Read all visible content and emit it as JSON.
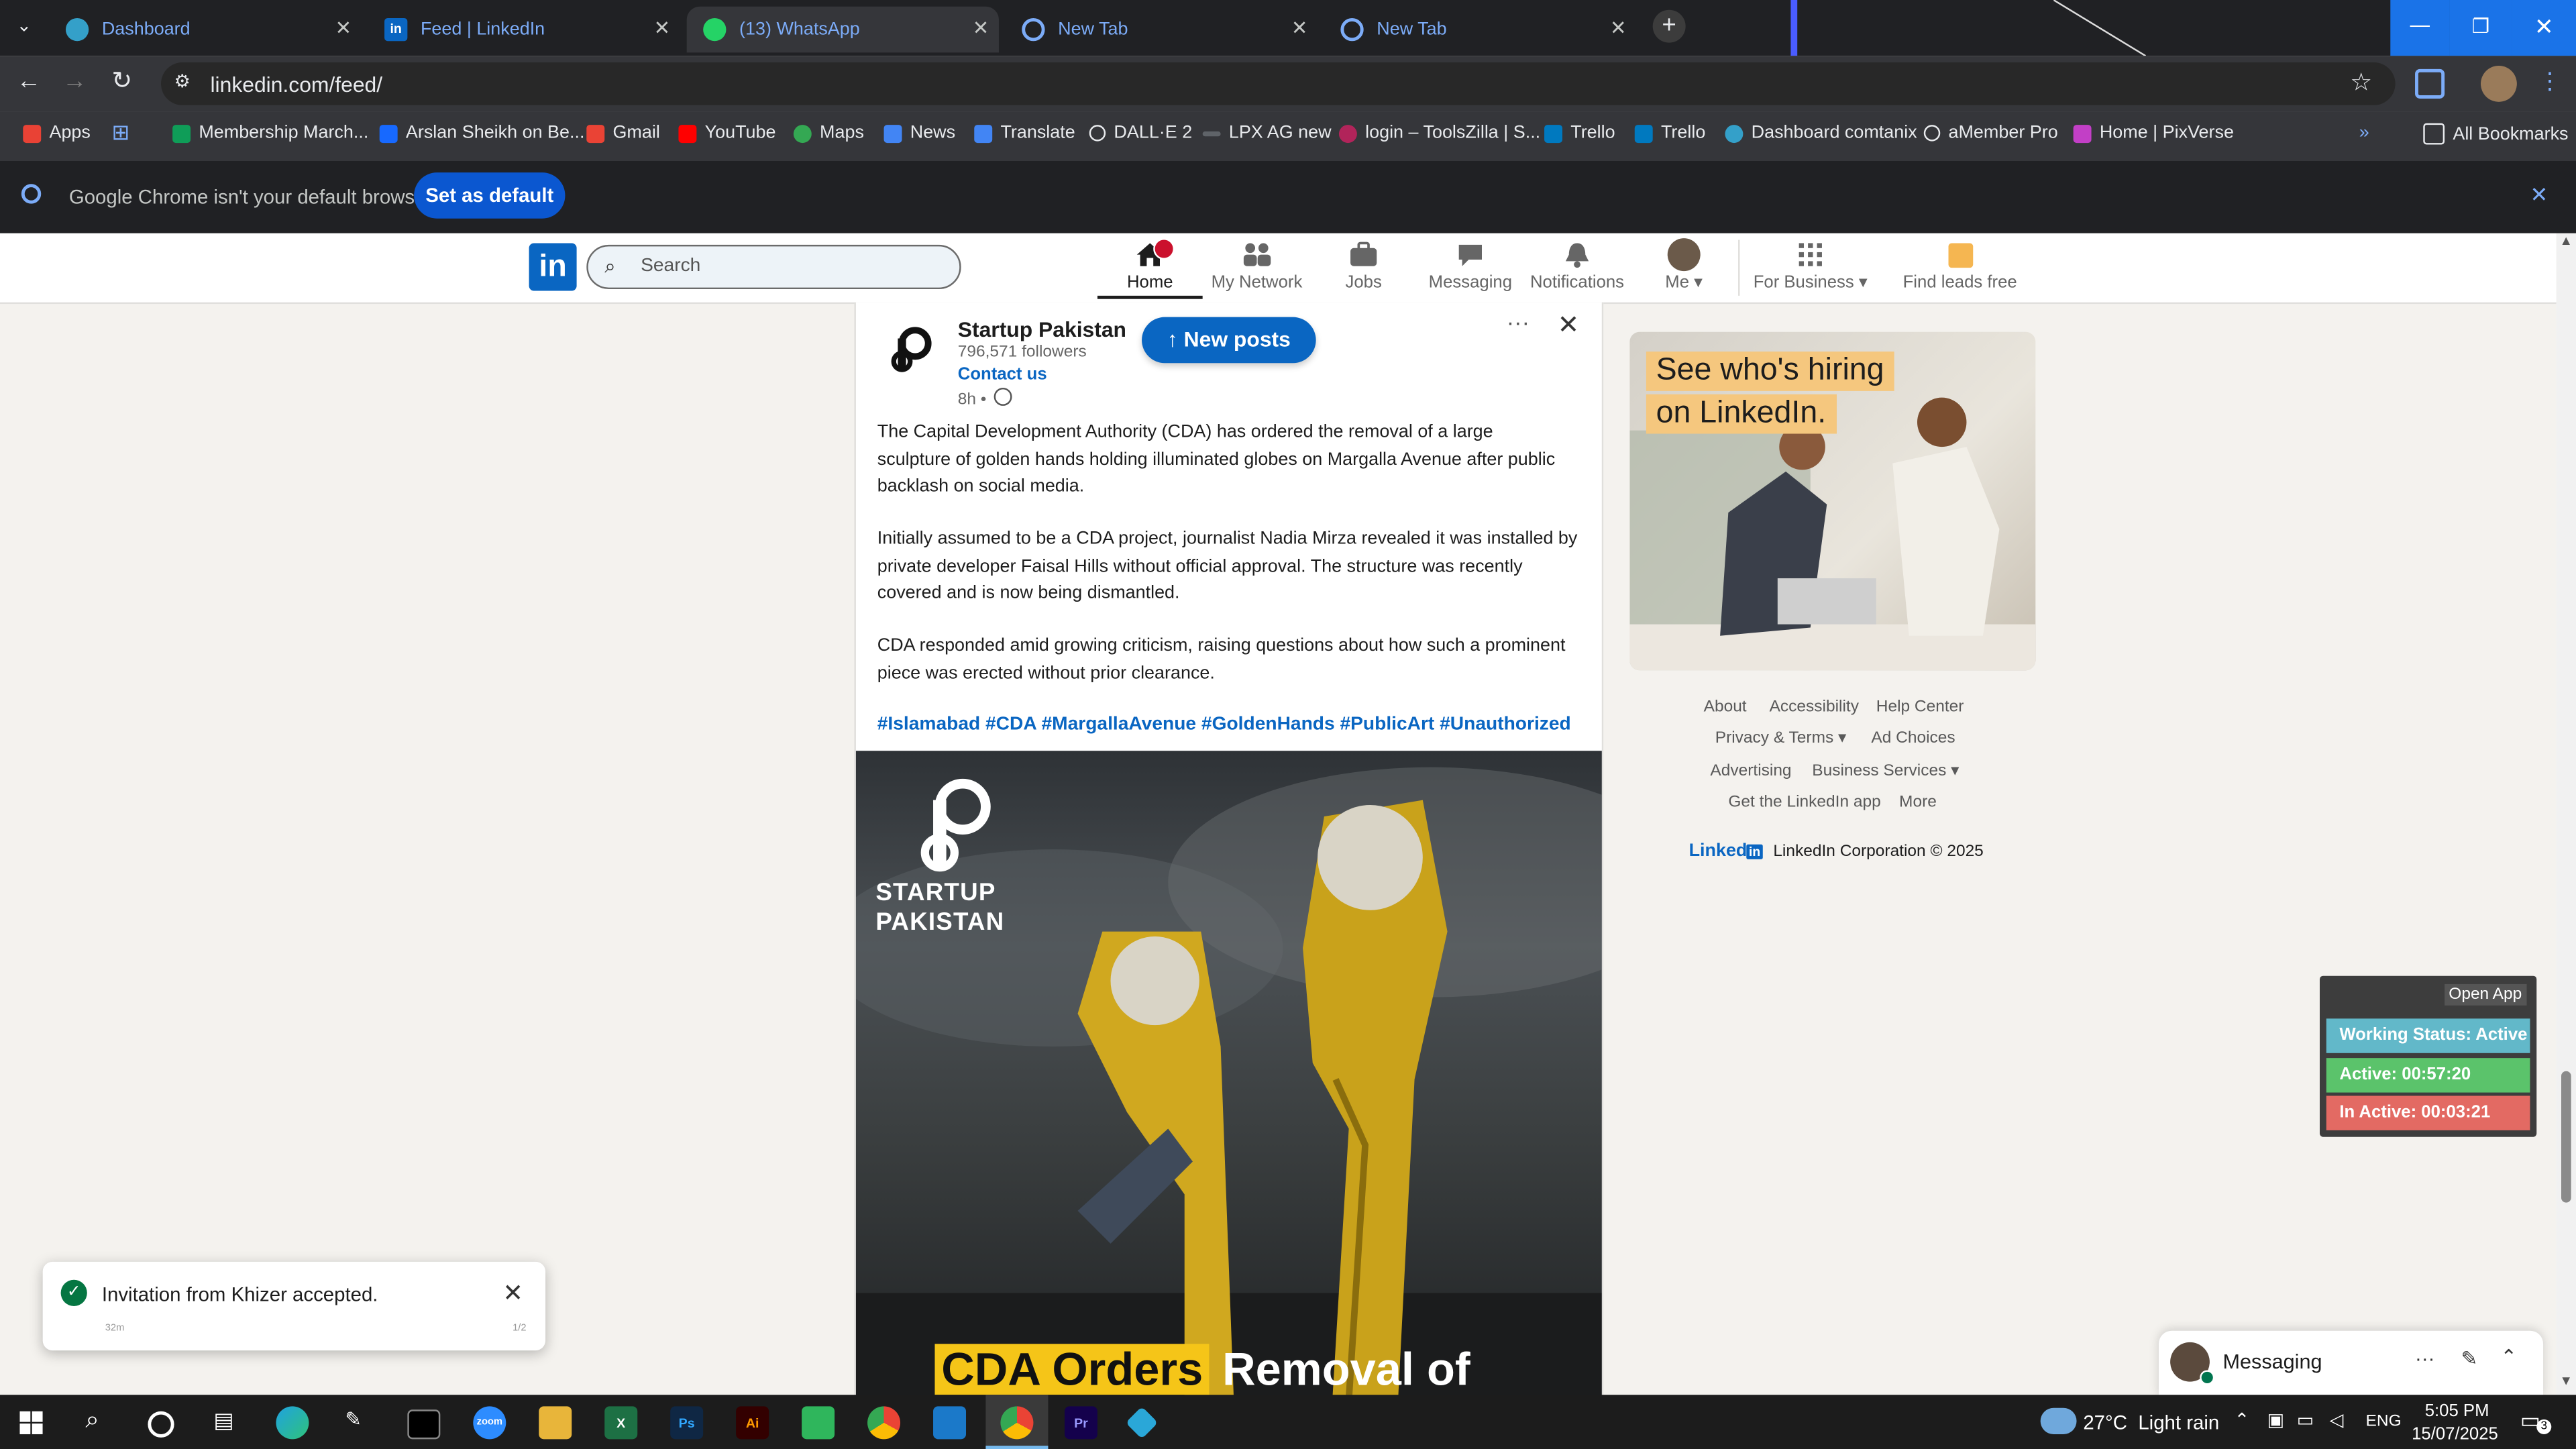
{
  "browser": {
    "tabs": [
      {
        "title": "Dashboard",
        "icon": "dashboard-favicon-icon",
        "color": "#34a0c9"
      },
      {
        "title": "Feed | LinkedIn",
        "icon": "linkedin-favicon-icon",
        "color": "#0a66c2"
      },
      {
        "title": "(13) WhatsApp",
        "icon": "whatsapp-favicon-icon",
        "color": "#25d366"
      },
      {
        "title": "New Tab",
        "icon": "chrome-favicon-icon",
        "color": "#7cacf8"
      },
      {
        "title": "New Tab",
        "icon": "chrome-favicon-icon",
        "color": "#7cacf8"
      }
    ],
    "url": "linkedin.com/feed/",
    "bookmarks": [
      {
        "label": "Apps",
        "color": "#e94235"
      },
      {
        "label": "Membership March...",
        "color": "#0f9d58"
      },
      {
        "label": "Arslan Sheikh on Be...",
        "color": "#1769ff"
      },
      {
        "label": "Gmail",
        "color": "#ea4335"
      },
      {
        "label": "YouTube",
        "color": "#ff0000"
      },
      {
        "label": "Maps",
        "color": "#34a853"
      },
      {
        "label": "News",
        "color": "#4285f4"
      },
      {
        "label": "Translate",
        "color": "#4285f4"
      },
      {
        "label": "DALL·E 2",
        "color": "#e8eaed"
      },
      {
        "label": "LPX AG new",
        "color": "#9aa0a6"
      },
      {
        "label": "login – ToolsZilla | S...",
        "color": "#b1245a"
      },
      {
        "label": "Trello",
        "color": "#0079bf"
      },
      {
        "label": "Trello",
        "color": "#0079bf"
      },
      {
        "label": "Dashboard comtanix",
        "color": "#34a0c9"
      },
      {
        "label": "aMember Pro",
        "color": "#e8eaed"
      },
      {
        "label": "Home | PixVerse",
        "color": "#c23fc6"
      }
    ],
    "all_bookmarks": "All Bookmarks",
    "infobar": {
      "text": "Google Chrome isn't your default browser",
      "button": "Set as default"
    }
  },
  "linkedin": {
    "search_placeholder": "Search",
    "nav": [
      {
        "label": "Home",
        "icon": "home-icon"
      },
      {
        "label": "My Network",
        "icon": "network-icon"
      },
      {
        "label": "Jobs",
        "icon": "briefcase-icon"
      },
      {
        "label": "Messaging",
        "icon": "chat-icon"
      },
      {
        "label": "Notifications",
        "icon": "bell-icon"
      },
      {
        "label": "Me",
        "icon": "avatar-icon"
      },
      {
        "label": "For Business",
        "icon": "grid-icon"
      },
      {
        "label": "Find leads free",
        "icon": "leads-icon"
      }
    ],
    "post": {
      "author": "Startup Pakistan",
      "followers": "796,571 followers",
      "contact": "Contact us",
      "time": "8h •",
      "new_posts": "New posts",
      "paragraphs": [
        "The Capital Development Authority (CDA) has ordered the removal of a large sculpture of golden hands holding illuminated globes on Margalla Avenue after public backlash on social media.",
        "Initially assumed to be a CDA project, journalist Nadia Mirza revealed it was installed by private developer Faisal Hills without official approval. The structure was recently covered and is now being dismantled.",
        "CDA responded amid growing criticism, raising questions about how such a prominent piece was erected without prior clearance."
      ],
      "hashtags": "#Islamabad #CDA #MargallaAvenue #GoldenHands #PublicArt #Unauthorized",
      "image_logo_line1": "STARTUP",
      "image_logo_line2": "PAKISTAN",
      "image_headline_a": "CDA Orders",
      "image_headline_b": "Removal of"
    },
    "ad": {
      "line1": "See who's hiring",
      "line2": "on LinkedIn."
    },
    "footer": {
      "about": "About",
      "accessibility": "Accessibility",
      "help": "Help Center",
      "privacy": "Privacy & Terms",
      "adchoices": "Ad Choices",
      "advertising": "Advertising",
      "business": "Business Services",
      "app": "Get the LinkedIn app",
      "more": "More",
      "brand": "Linked",
      "copyright": "LinkedIn Corporation © 2025"
    },
    "messaging": "Messaging"
  },
  "status_widget": {
    "open_app": "Open App",
    "working": "Working Status: Active",
    "active": "Active: 00:57:20",
    "inactive": "In Active: 00:03:21",
    "colors": {
      "working": "#62b8c9",
      "active": "#5bc36b",
      "inactive": "#e36a63"
    }
  },
  "toast": {
    "text": "Invitation from Khizer accepted.",
    "time": "32m",
    "count": "1/2"
  },
  "taskbar": {
    "weather": "27°C  Light rain",
    "lang": "ENG",
    "time": "5:05 PM",
    "date": "15/07/2025",
    "apps": [
      {
        "icon": "zoom-icon",
        "color": "#2d8cff",
        "label": "zoom"
      },
      {
        "icon": "file-explorer-icon",
        "color": "#e8b53a",
        "label": ""
      },
      {
        "icon": "excel-icon",
        "color": "#1d7044",
        "label": "X"
      },
      {
        "icon": "photoshop-icon",
        "color": "#0f2744",
        "label": "Ps"
      },
      {
        "icon": "illustrator-icon",
        "color": "#330000",
        "label": "Ai"
      },
      {
        "icon": "app-green-icon",
        "color": "#2fb65c",
        "label": ""
      },
      {
        "icon": "chrome-icon",
        "color": "#f2b32a",
        "label": ""
      },
      {
        "icon": "vscode-icon",
        "color": "#1b79c9",
        "label": ""
      },
      {
        "icon": "chrome-active-icon",
        "color": "#db4437",
        "label": ""
      },
      {
        "icon": "premiere-icon",
        "color": "#14014c",
        "label": "Pr"
      },
      {
        "icon": "app-blue-icon",
        "color": "#2aa7d8",
        "label": ""
      }
    ]
  }
}
